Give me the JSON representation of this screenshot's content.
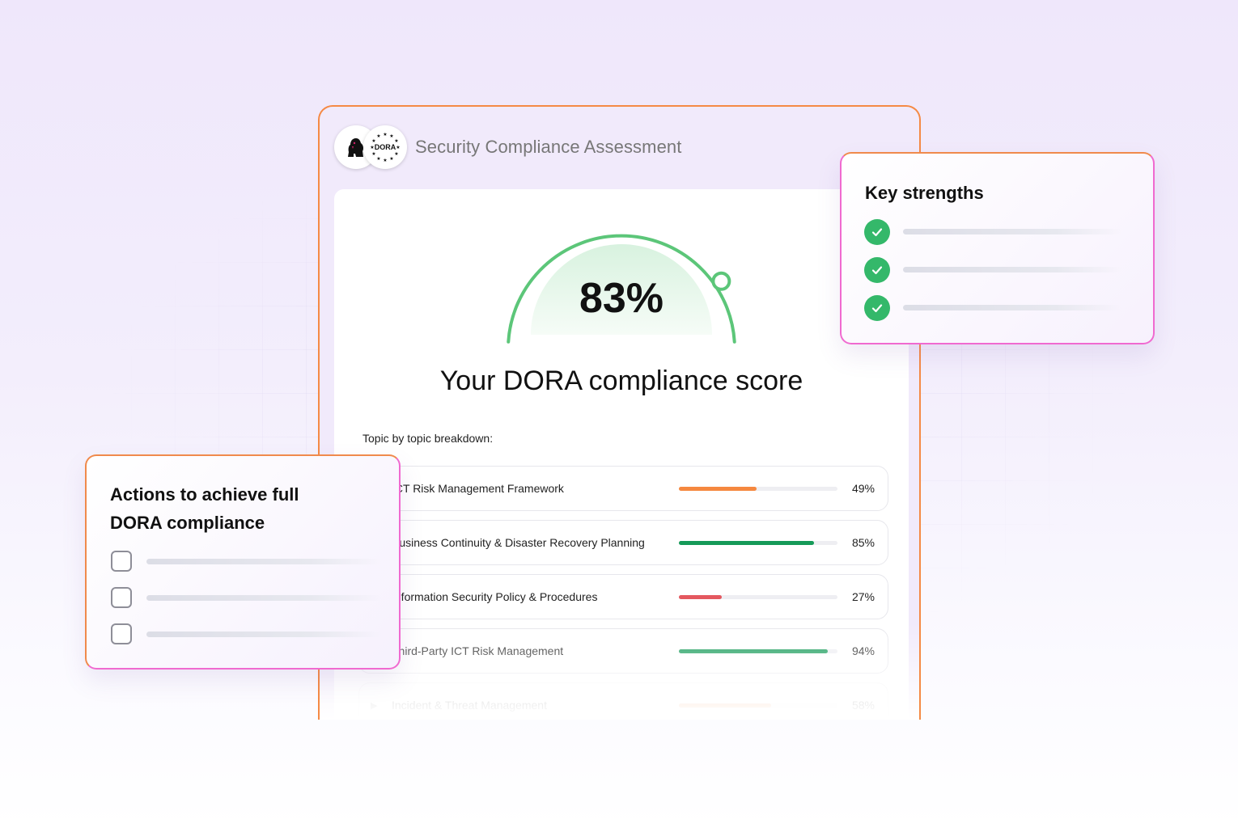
{
  "header": {
    "title": "Security Compliance Assessment",
    "dora_logo_text": "DORA"
  },
  "score": {
    "value_label": "83%",
    "value_fraction": 0.83,
    "subtitle": "Your DORA compliance score"
  },
  "breakdown": {
    "label": "Topic by topic breakdown:",
    "topics": [
      {
        "label": "ICT Risk Management Framework",
        "pct_label": "49%",
        "value": 49,
        "color": "#f5883f"
      },
      {
        "label": "Business Continuity & Disaster Recovery Planning",
        "pct_label": "85%",
        "value": 85,
        "color": "#159a58"
      },
      {
        "label": "Information Security Policy & Procedures",
        "pct_label": "27%",
        "value": 27,
        "color": "#e4585f"
      },
      {
        "label": "Third-Party ICT Risk Management",
        "pct_label": "94%",
        "value": 94,
        "color": "#159a58"
      },
      {
        "label": "Incident & Threat Management",
        "pct_label": "58%",
        "value": 58,
        "color": "#f5883f"
      }
    ]
  },
  "strengths": {
    "title": "Key strengths",
    "items": 3
  },
  "actions": {
    "title_line1": "Actions to achieve full",
    "title_line2": "DORA compliance",
    "items": 3
  },
  "colors": {
    "gauge": "#5cc679",
    "check": "#34b86a",
    "border_orange": "#f58a45",
    "border_pink": "#f06ad0"
  }
}
